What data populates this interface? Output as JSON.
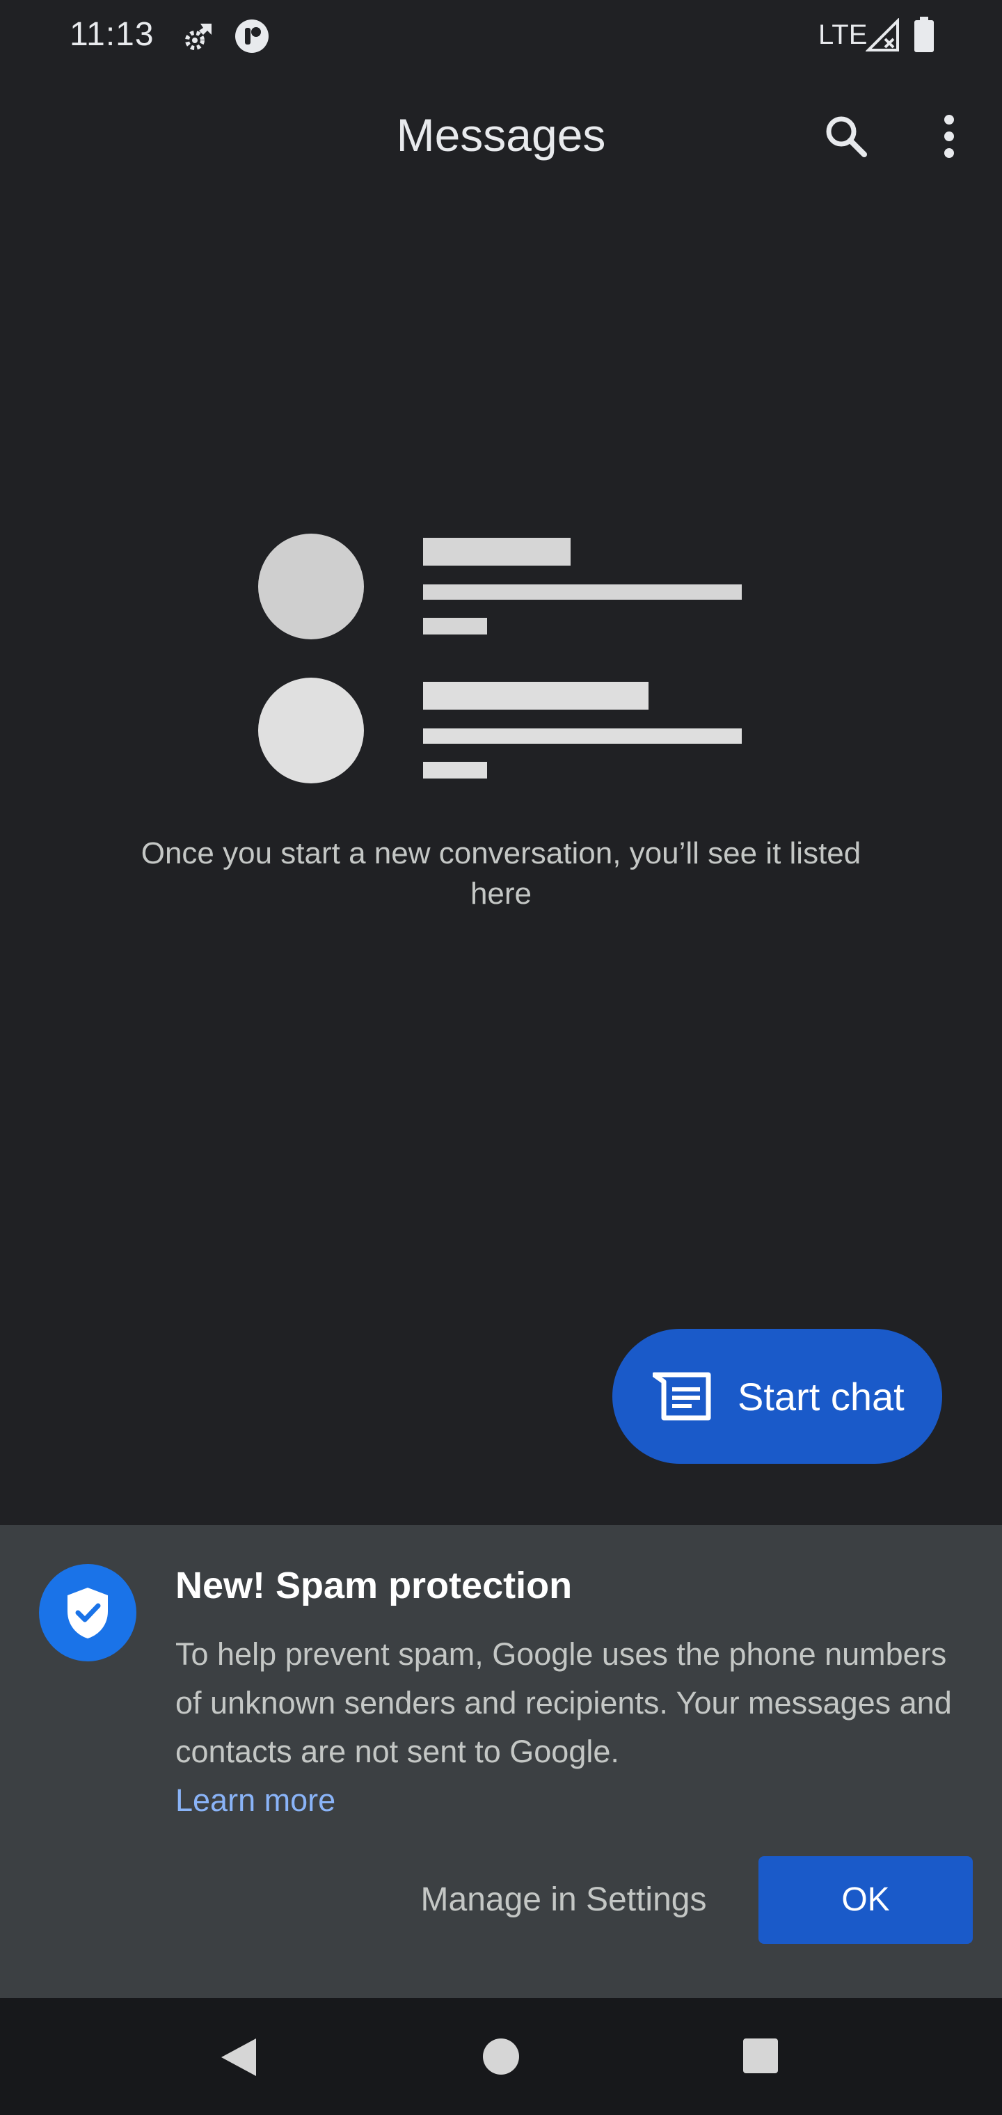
{
  "status_bar": {
    "time": "11:13",
    "network": "LTE",
    "icons": [
      "settings-sync-icon",
      "assistant-icon",
      "signal-icon",
      "battery-icon"
    ]
  },
  "app_bar": {
    "title": "Messages",
    "icons": [
      "search-icon",
      "more-vert-icon"
    ]
  },
  "empty_state": {
    "text": "Once you start a new conversation, you’ll see it listed here"
  },
  "fab": {
    "label": "Start chat",
    "icon": "chat-icon"
  },
  "spam_sheet": {
    "title": "New! Spam protection",
    "body": "To help prevent spam, Google uses the phone numbers of unknown senders and recipients. Your messages and contacts are not sent to Google.",
    "learn_more": "Learn more",
    "manage_label": "Manage in Settings",
    "ok_label": "OK",
    "icon": "shield-check-icon"
  },
  "nav_bar": {
    "icons": [
      "back-icon",
      "home-icon",
      "recents-icon"
    ]
  },
  "colors": {
    "background": "#202124",
    "accent": "#1a5ac9",
    "link": "#8ab4f8",
    "sheet": "#3c4043"
  }
}
